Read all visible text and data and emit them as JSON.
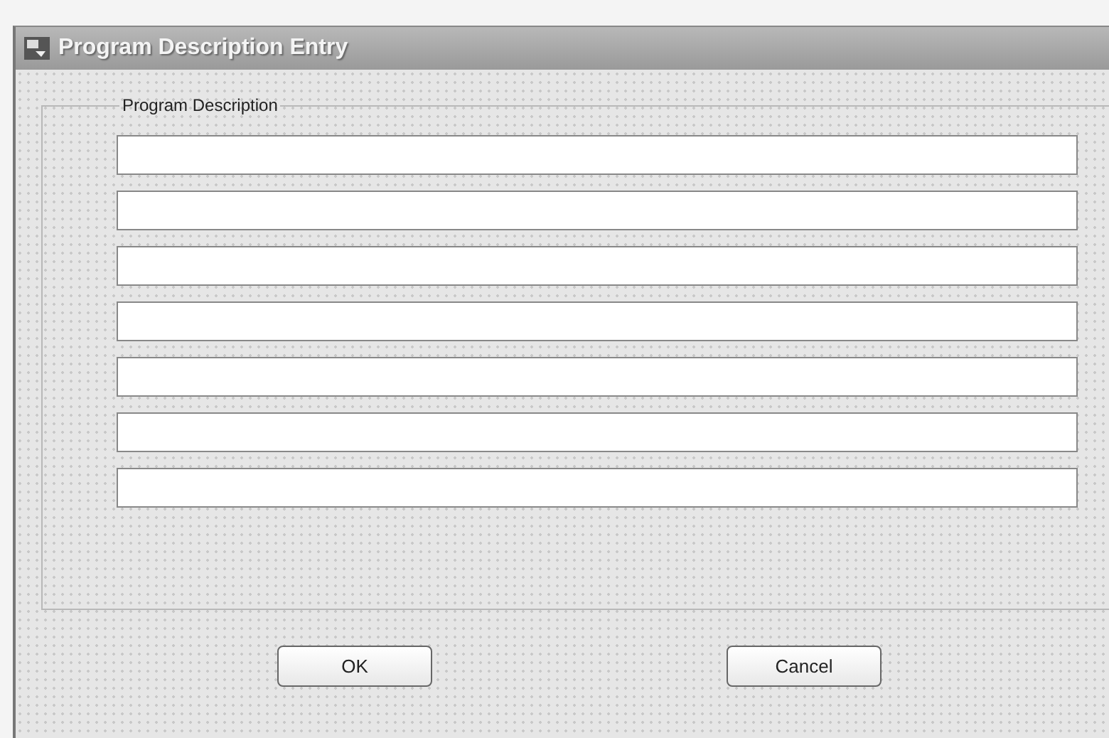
{
  "window": {
    "title": "Program Description Entry"
  },
  "group": {
    "label": "Program Description"
  },
  "fields": [
    {
      "kind": "text"
    },
    {
      "kind": "text"
    },
    {
      "kind": "text"
    },
    {
      "kind": "text"
    },
    {
      "kind": "text"
    },
    {
      "kind": "text"
    },
    {
      "kind": "text"
    }
  ],
  "buttons": [
    "OK",
    "Cancel"
  ]
}
